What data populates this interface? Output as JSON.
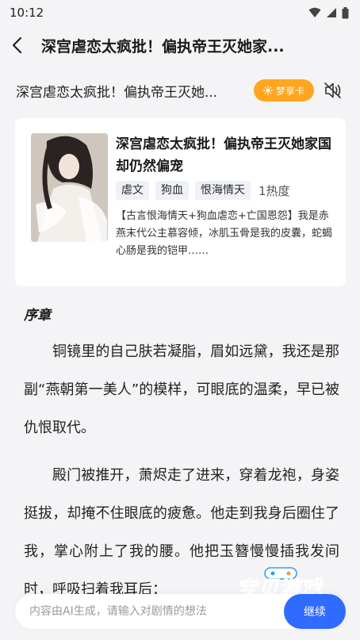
{
  "status": {
    "time": "10:12"
  },
  "header": {
    "title": "深宫虐恋太疯批！偏执帝王灭她家..."
  },
  "sub_row": {
    "title": "深宫虐恋太疯批！偏执帝王灭她...",
    "dream_card_label": "梦享卡"
  },
  "book": {
    "title": "深宫虐恋太疯批！偏执帝王灭她家国却仍然偏宠",
    "tags": [
      "虐文",
      "狗血",
      "恨海情天"
    ],
    "heat": "1热度",
    "description": "【古言恨海情天+狗血虐恋+亡国恩怨】我是赤燕末代公主慕容倾，冰肌玉骨是我的皮囊，蛇蝎心肠是我的铠甲……"
  },
  "content": {
    "chapter": "序章",
    "paragraphs": [
      "铜镜里的自己肤若凝脂，眉如远黛，我还是那副“燕朝第一美人”的模样，可眼底的温柔，早已被仇恨取代。",
      "殿门被推开，萧烬走了进来，穿着龙袍，身姿挺拔，却掩不住眼底的疲惫。他走到我身后圈住了我，掌心附上了我的腰。他把玉簪慢慢插我发间时，呼吸扫着我耳后："
    ]
  },
  "input": {
    "placeholder": "内容由AI生成，请输入对剧情的想法",
    "button_label": "继续"
  },
  "watermark": {
    "text": "宝贝游戏网",
    "url": "baobeiy.com"
  },
  "colors": {
    "accent": "#ffa51f",
    "primary": "#2f6bff",
    "background": "#f4f4f6"
  }
}
